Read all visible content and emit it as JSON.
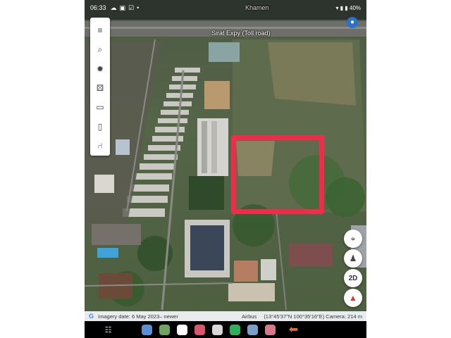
{
  "status_bar": {
    "time": "06:33",
    "right_icons": "▾ ▮ ▮ 40%"
  },
  "map": {
    "area_label": "Khamen",
    "road_label": "Sirat Expy (Toll road)"
  },
  "toolbar": {
    "items": [
      {
        "icon": "menu-icon",
        "glyph": "≡"
      },
      {
        "icon": "search-icon",
        "glyph": "⌕"
      },
      {
        "icon": "voyager-icon",
        "glyph": "✹"
      },
      {
        "icon": "feeling-lucky-icon",
        "glyph": "⚄"
      },
      {
        "icon": "measure-icon",
        "glyph": "▭"
      },
      {
        "icon": "projects-icon",
        "glyph": "▯"
      },
      {
        "icon": "share-icon",
        "glyph": "⑁"
      }
    ]
  },
  "controls": {
    "locate_glyph": "⌖",
    "pegman_glyph": "♟",
    "view_mode": "2D",
    "compass_glyph": "▲"
  },
  "info_bar": {
    "logo": "G",
    "imagery_date": "Imagery date: 6 May 2023– newer",
    "provider": "Airbus",
    "coordinates": "(13°45'37\"N 100°35'16\"E) Camera: 214 m"
  },
  "nav_bar": {
    "apps": [
      {
        "name": "gallery-app-icon",
        "color": "#5a8fd6"
      },
      {
        "name": "phone-app-icon",
        "color": "#6fa35f"
      },
      {
        "name": "calendar-app-icon",
        "color": "#ffffff"
      },
      {
        "name": "camera-app-icon",
        "color": "#d9566b"
      },
      {
        "name": "mail-app-icon",
        "color": "#d8d8d8"
      },
      {
        "name": "chrome-app-icon",
        "color": "#2eaf5c"
      },
      {
        "name": "docs-app-icon",
        "color": "#7aa0c9"
      },
      {
        "name": "box-app-icon",
        "color": "#d77a8c"
      }
    ]
  },
  "colors": {
    "selection_box": "#ef2d4a",
    "locate_accent": "#2a72c9"
  }
}
